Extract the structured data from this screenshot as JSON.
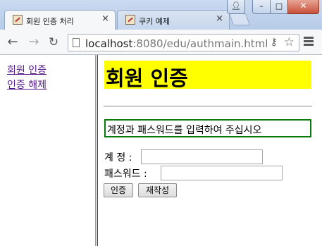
{
  "browser": {
    "tabs": [
      {
        "title": "회원 인증 처리",
        "close": "×",
        "active": true
      },
      {
        "title": "쿠키 예제",
        "close": "×",
        "active": false
      }
    ],
    "address": {
      "host": "localhost",
      "rest": ":8080/edu/authmain.html"
    },
    "window_controls": {
      "minimize": "–",
      "maximize": "□",
      "close": "✕"
    }
  },
  "nav_frame": {
    "links": [
      {
        "label": "회원 인증"
      },
      {
        "label": "인증 해제"
      }
    ]
  },
  "main_frame": {
    "heading": "회원 인증",
    "notice": "계정과 패스워드를 입력하여 주십시오",
    "form": {
      "account_label": "계 정 :",
      "account_value": "",
      "password_label": "패스워드 :",
      "password_value": "",
      "submit_label": "인증",
      "reset_label": "재작성"
    }
  },
  "colors": {
    "heading_background": "#ffff00",
    "notice_border": "#0a7a0a",
    "link": "#551a8b"
  }
}
